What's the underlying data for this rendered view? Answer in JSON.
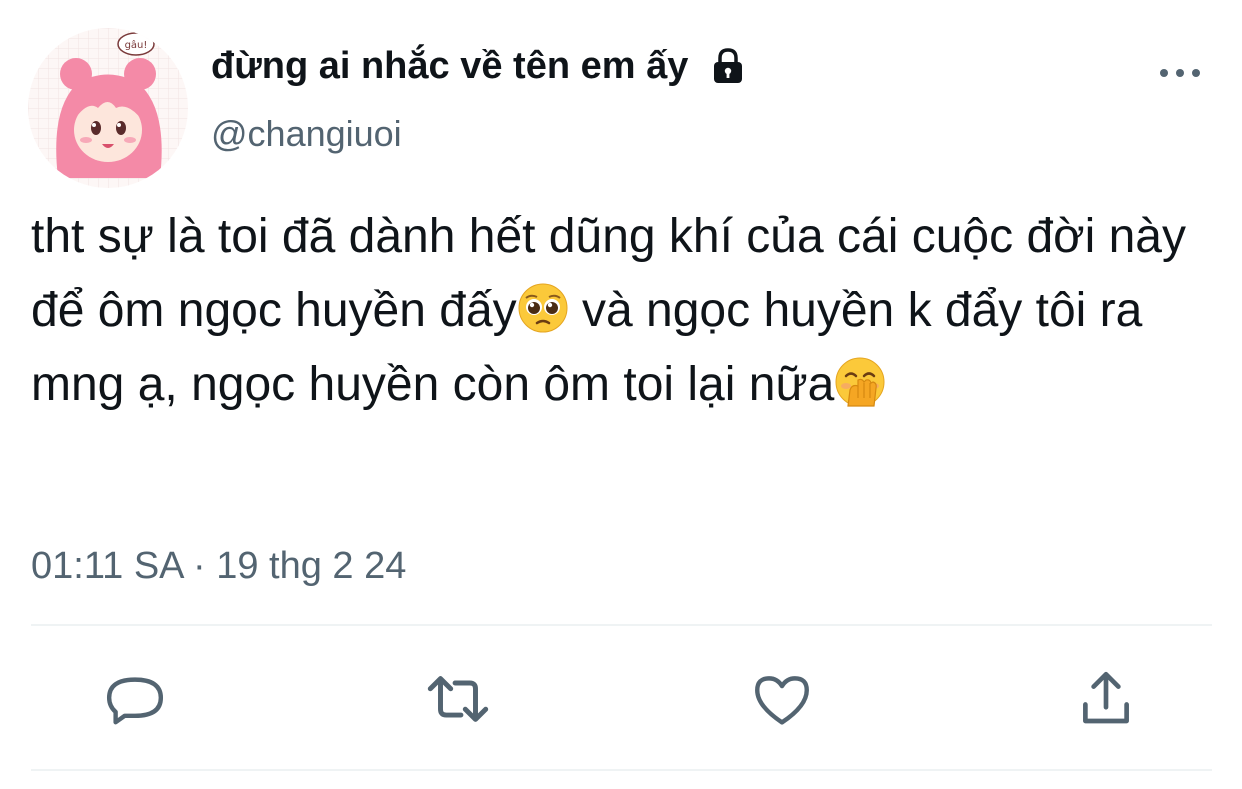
{
  "user": {
    "display_name": "đừng ai nhắc về tên em ấy",
    "handle": "@changiuoi",
    "protected_icon": "lock-icon",
    "avatar_text": "gâu!"
  },
  "tweet": {
    "text_part1": "tht sự là toi đã dành hết dũng khí của cái cuộc đời này để ôm ngọc huyền đấy",
    "emoji1": "pleading-face-emoji",
    "text_part2": " và ngọc huyền k đẩy tôi ra mng ạ, ngọc huyền còn ôm toi lại nữa",
    "emoji2": "face-with-hand-over-mouth-emoji",
    "timestamp": "01:11 SA · 19 thg 2 24"
  },
  "icons": {
    "more": "more-icon",
    "reply": "reply-icon",
    "retweet": "retweet-icon",
    "like": "heart-icon",
    "share": "share-icon"
  },
  "colors": {
    "text": "#0f1419",
    "secondary": "#536471",
    "icon": "#536471",
    "divider": "#eff3f4",
    "avatar_hair": "#f48aa7"
  }
}
